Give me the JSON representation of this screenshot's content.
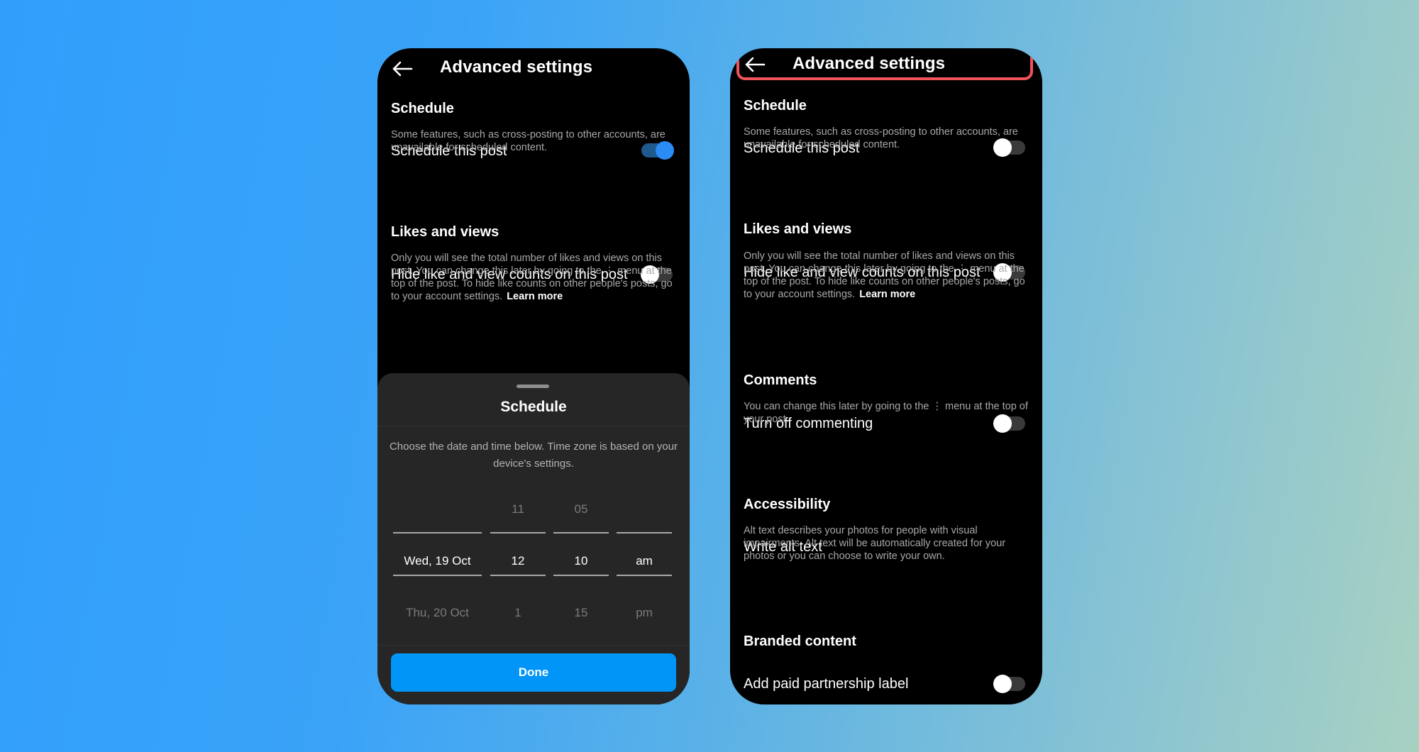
{
  "left_phone": {
    "header": {
      "title": "Advanced settings"
    },
    "schedule": {
      "section_title": "Schedule",
      "row_label": "Schedule this post",
      "toggle_on": true,
      "description": "Some features, such as cross-posting to other accounts, are unavailable for scheduled content."
    },
    "likes": {
      "section_title": "Likes and views",
      "row_label": "Hide like and view counts on this post",
      "toggle_on": false,
      "description": "Only you will see the total number of likes and views on this post. You can change this later by going to the ⋮ menu at the top of the post. To hide like counts on other people's posts, go to your account settings.",
      "learn_more": "Learn more"
    },
    "sheet": {
      "title": "Schedule",
      "description": "Choose the date and time below. Time zone is based on your device's settings.",
      "picker": {
        "date": {
          "above": "",
          "selected": "Wed, 19 Oct",
          "below": "Thu, 20 Oct"
        },
        "hour": {
          "above": "11",
          "selected": "12",
          "below": "1"
        },
        "minute": {
          "above": "05",
          "selected": "10",
          "below": "15"
        },
        "ampm": {
          "above": "",
          "selected": "am",
          "below": "pm"
        }
      },
      "done_label": "Done"
    }
  },
  "right_phone": {
    "header": {
      "title": "Advanced settings"
    },
    "schedule": {
      "section_title": "Schedule",
      "row_label": "Schedule this post",
      "toggle_on": false,
      "description": "Some features, such as cross-posting to other accounts, are unavailable for scheduled content."
    },
    "likes": {
      "section_title": "Likes and views",
      "row_label": "Hide like and view counts on this post",
      "toggle_on": false,
      "description": "Only you will see the total number of likes and views on this post. You can change this later by going to the ⋮ menu at the top of the post. To hide like counts on other people's posts, go to your account settings.",
      "learn_more": "Learn more"
    },
    "comments": {
      "section_title": "Comments",
      "row_label": "Turn off commenting",
      "toggle_on": false,
      "description": "You can change this later by going to the ⋮ menu at the top of your post."
    },
    "accessibility": {
      "section_title": "Accessibility",
      "row_label": "Write alt text",
      "description": "Alt text describes your photos for people with visual impairments. Alt text will be automatically created for your photos or you can choose to write your own."
    },
    "branded": {
      "section_title": "Branded content",
      "row_label": "Add paid partnership label",
      "toggle_on": false
    }
  },
  "colors": {
    "highlight": "#ee5459",
    "accent": "#0095f6",
    "toggle_on_knob": "#2b8cf5",
    "phone_bg": "#000000",
    "sheet_bg": "#262626"
  },
  "icons": {
    "back": "arrow-left-icon"
  }
}
